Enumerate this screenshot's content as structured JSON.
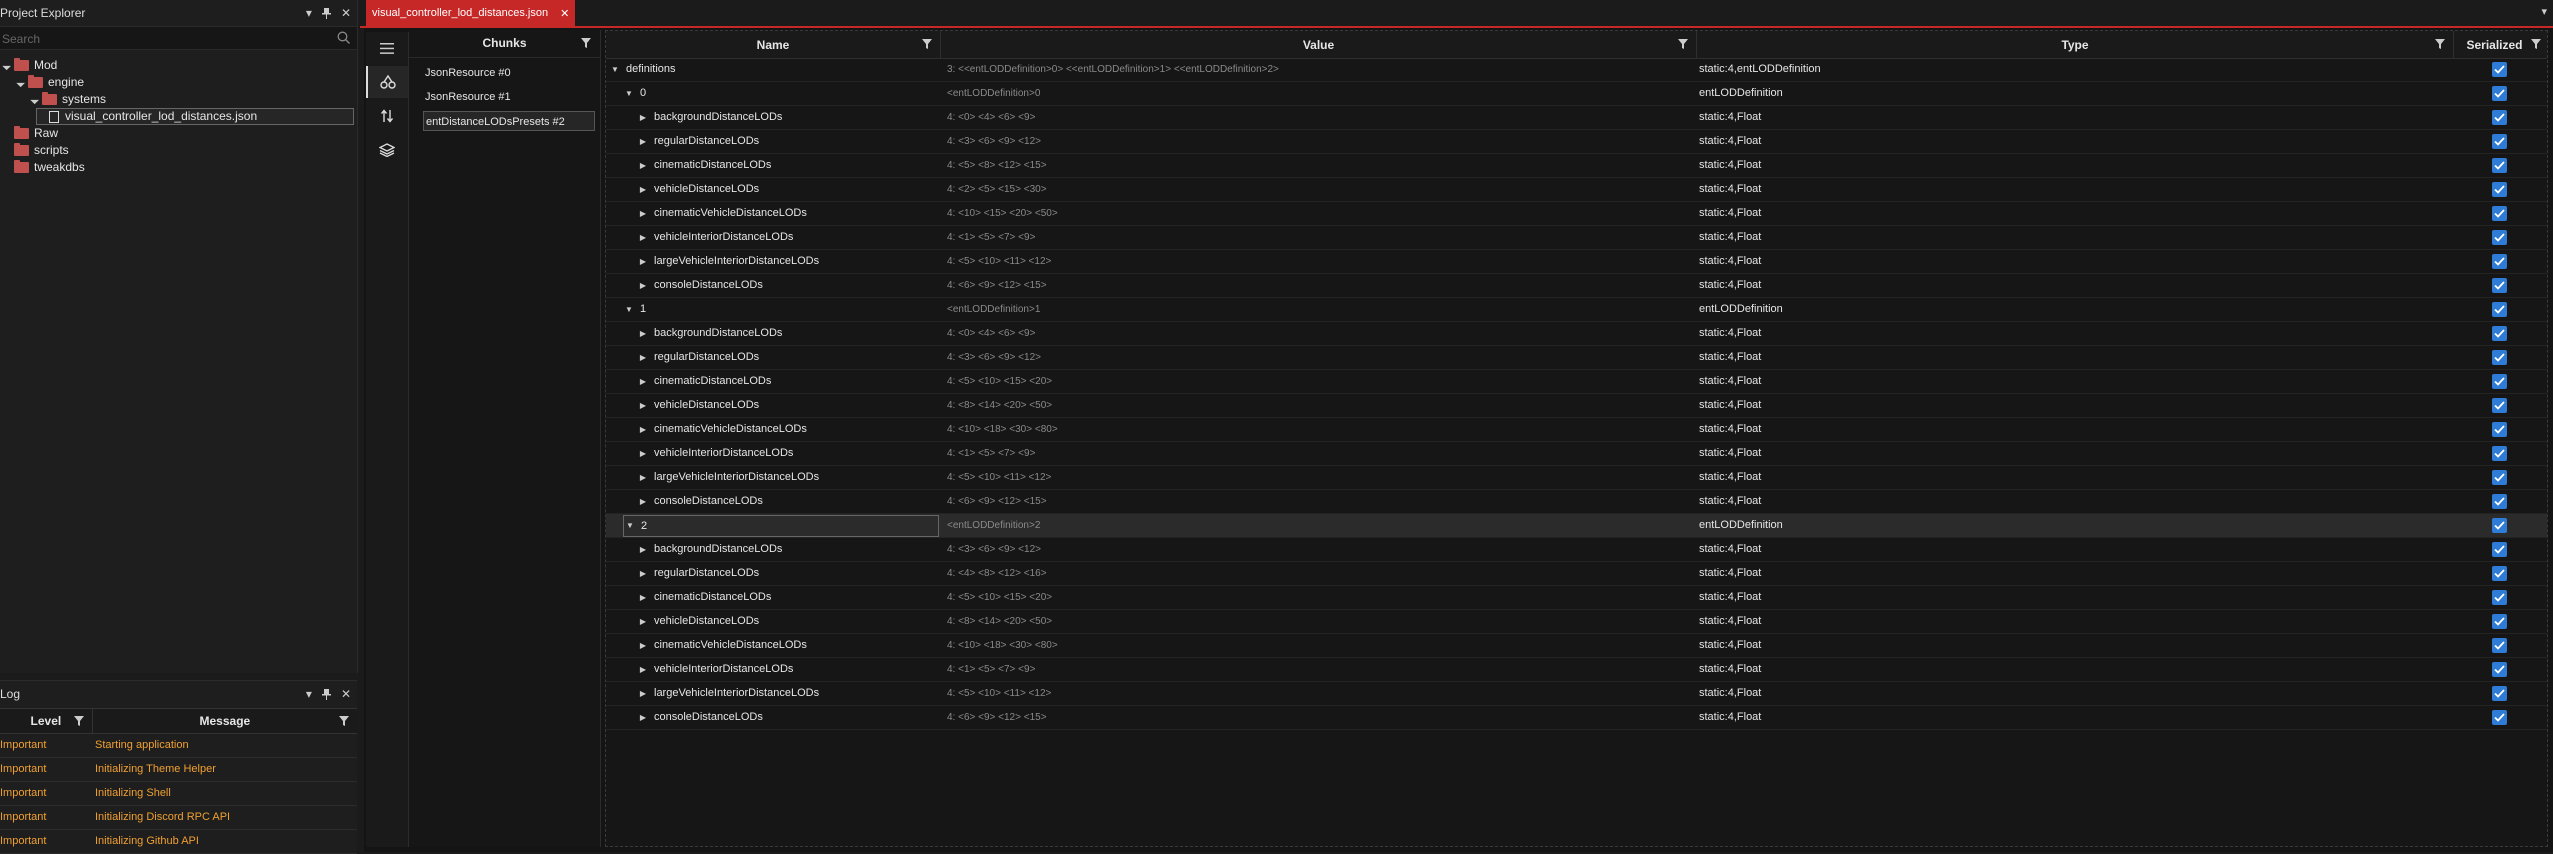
{
  "project_explorer": {
    "title": "Project Explorer",
    "search_placeholder": "Search",
    "tree": [
      {
        "label": "Mod",
        "depth": 0,
        "type": "folder",
        "expanded": true
      },
      {
        "label": "engine",
        "depth": 1,
        "type": "folder",
        "expanded": true
      },
      {
        "label": "systems",
        "depth": 2,
        "type": "folder",
        "expanded": true
      },
      {
        "label": "visual_controller_lod_distances.json",
        "depth": 3,
        "type": "file",
        "selected": true
      },
      {
        "label": "Raw",
        "depth": 0,
        "type": "folder"
      },
      {
        "label": "scripts",
        "depth": 0,
        "type": "folder"
      },
      {
        "label": "tweakdbs",
        "depth": 0,
        "type": "folder"
      }
    ]
  },
  "log": {
    "title": "Log",
    "columns": {
      "level": "Level",
      "message": "Message"
    },
    "rows": [
      {
        "level": "Important",
        "message": "Starting application"
      },
      {
        "level": "Important",
        "message": "Initializing Theme Helper"
      },
      {
        "level": "Important",
        "message": "Initializing Shell"
      },
      {
        "level": "Important",
        "message": "Initializing Discord RPC API"
      },
      {
        "level": "Important",
        "message": "Initializing Github API"
      }
    ]
  },
  "tab": {
    "label": "visual_controller_lod_distances.json",
    "close": "✕"
  },
  "chunks": {
    "title": "Chunks",
    "items": [
      "JsonResource #0",
      "JsonResource #1",
      "entDistanceLODsPresets #2"
    ],
    "selected_index": 2
  },
  "grid": {
    "columns": {
      "name": "Name",
      "value": "Value",
      "type": "Type",
      "serialized": "Serialized"
    },
    "rows": [
      {
        "indent": 0,
        "expanded": true,
        "name": "definitions",
        "value": "3: <<entLODDefinition>0> <<entLODDefinition>1> <<entLODDefinition>2>",
        "type": "static:4,entLODDefinition"
      },
      {
        "indent": 1,
        "expanded": true,
        "name": "0",
        "value": "<entLODDefinition>0",
        "type": "entLODDefinition"
      },
      {
        "indent": 2,
        "expanded": false,
        "name": "backgroundDistanceLODs",
        "value": "4: <0> <4> <6> <9>",
        "type": "static:4,Float"
      },
      {
        "indent": 2,
        "expanded": false,
        "name": "regularDistanceLODs",
        "value": "4: <3> <6> <9> <12>",
        "type": "static:4,Float"
      },
      {
        "indent": 2,
        "expanded": false,
        "name": "cinematicDistanceLODs",
        "value": "4: <5> <8> <12> <15>",
        "type": "static:4,Float"
      },
      {
        "indent": 2,
        "expanded": false,
        "name": "vehicleDistanceLODs",
        "value": "4: <2> <5> <15> <30>",
        "type": "static:4,Float"
      },
      {
        "indent": 2,
        "expanded": false,
        "name": "cinematicVehicleDistanceLODs",
        "value": "4: <10> <15> <20> <50>",
        "type": "static:4,Float"
      },
      {
        "indent": 2,
        "expanded": false,
        "name": "vehicleInteriorDistanceLODs",
        "value": "4: <1> <5> <7> <9>",
        "type": "static:4,Float"
      },
      {
        "indent": 2,
        "expanded": false,
        "name": "largeVehicleInteriorDistanceLODs",
        "value": "4: <5> <10> <11> <12>",
        "type": "static:4,Float"
      },
      {
        "indent": 2,
        "expanded": false,
        "name": "consoleDistanceLODs",
        "value": "4: <6> <9> <12> <15>",
        "type": "static:4,Float"
      },
      {
        "indent": 1,
        "expanded": true,
        "name": "1",
        "value": "<entLODDefinition>1",
        "type": "entLODDefinition"
      },
      {
        "indent": 2,
        "expanded": false,
        "name": "backgroundDistanceLODs",
        "value": "4: <0> <4> <6> <9>",
        "type": "static:4,Float"
      },
      {
        "indent": 2,
        "expanded": false,
        "name": "regularDistanceLODs",
        "value": "4: <3> <6> <9> <12>",
        "type": "static:4,Float"
      },
      {
        "indent": 2,
        "expanded": false,
        "name": "cinematicDistanceLODs",
        "value": "4: <5> <10> <15> <20>",
        "type": "static:4,Float"
      },
      {
        "indent": 2,
        "expanded": false,
        "name": "vehicleDistanceLODs",
        "value": "4: <8> <14> <20> <50>",
        "type": "static:4,Float"
      },
      {
        "indent": 2,
        "expanded": false,
        "name": "cinematicVehicleDistanceLODs",
        "value": "4: <10> <18> <30> <80>",
        "type": "static:4,Float"
      },
      {
        "indent": 2,
        "expanded": false,
        "name": "vehicleInteriorDistanceLODs",
        "value": "4: <1> <5> <7> <9>",
        "type": "static:4,Float"
      },
      {
        "indent": 2,
        "expanded": false,
        "name": "largeVehicleInteriorDistanceLODs",
        "value": "4: <5> <10> <11> <12>",
        "type": "static:4,Float"
      },
      {
        "indent": 2,
        "expanded": false,
        "name": "consoleDistanceLODs",
        "value": "4: <6> <9> <12> <15>",
        "type": "static:4,Float"
      },
      {
        "indent": 1,
        "expanded": true,
        "name": "2",
        "value": "<entLODDefinition>2",
        "type": "entLODDefinition",
        "selected": true
      },
      {
        "indent": 2,
        "expanded": false,
        "name": "backgroundDistanceLODs",
        "value": "4: <3> <6> <9> <12>",
        "type": "static:4,Float"
      },
      {
        "indent": 2,
        "expanded": false,
        "name": "regularDistanceLODs",
        "value": "4: <4> <8> <12> <16>",
        "type": "static:4,Float"
      },
      {
        "indent": 2,
        "expanded": false,
        "name": "cinematicDistanceLODs",
        "value": "4: <5> <10> <15> <20>",
        "type": "static:4,Float"
      },
      {
        "indent": 2,
        "expanded": false,
        "name": "vehicleDistanceLODs",
        "value": "4: <8> <14> <20> <50>",
        "type": "static:4,Float"
      },
      {
        "indent": 2,
        "expanded": false,
        "name": "cinematicVehicleDistanceLODs",
        "value": "4: <10> <18> <30> <80>",
        "type": "static:4,Float"
      },
      {
        "indent": 2,
        "expanded": false,
        "name": "vehicleInteriorDistanceLODs",
        "value": "4: <1> <5> <7> <9>",
        "type": "static:4,Float"
      },
      {
        "indent": 2,
        "expanded": false,
        "name": "largeVehicleInteriorDistanceLODs",
        "value": "4: <5> <10> <11> <12>",
        "type": "static:4,Float"
      },
      {
        "indent": 2,
        "expanded": false,
        "name": "consoleDistanceLODs",
        "value": "4: <6> <9> <12> <15>",
        "type": "static:4,Float"
      }
    ]
  },
  "colors": {
    "accent": "#c62828",
    "checkbox": "#2f7cd6",
    "log_text": "#f0a030",
    "folder": "#c0504d"
  },
  "icons": {
    "pin": "pin-icon",
    "close": "close-icon",
    "dropdown": "chevron-down-icon",
    "filter": "filter-icon",
    "search": "search-icon"
  }
}
